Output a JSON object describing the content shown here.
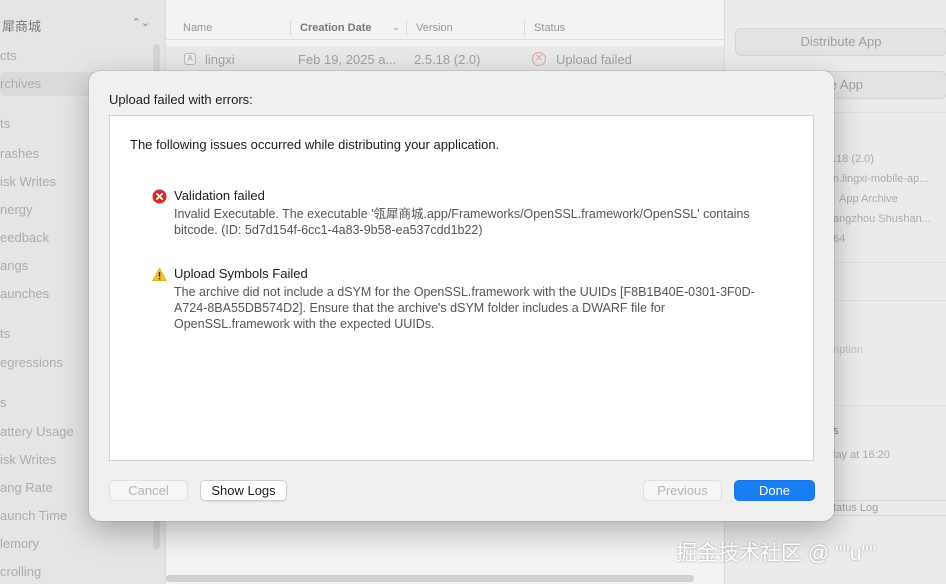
{
  "sidebar": {
    "scheme_name": "犀商城",
    "items": [
      {
        "label": "cts"
      },
      {
        "label": "rchives"
      },
      {
        "label": "ts"
      },
      {
        "label": "rashes"
      },
      {
        "label": "isk Writes"
      },
      {
        "label": "nergy"
      },
      {
        "label": "eedback"
      },
      {
        "label": "angs"
      },
      {
        "label": "aunches"
      },
      {
        "label": "ts"
      },
      {
        "label": "egressions"
      },
      {
        "label": "s"
      },
      {
        "label": "attery Usage"
      },
      {
        "label": "isk Writes"
      },
      {
        "label": "ang Rate"
      },
      {
        "label": "aunch Time"
      },
      {
        "label": "lemory"
      },
      {
        "label": "crolling"
      }
    ]
  },
  "table": {
    "columns": [
      "Name",
      "Creation Date",
      "Version",
      "Status"
    ],
    "rows": [
      {
        "name": "lingxi",
        "date": "Feb 19, 2025 a...",
        "version": "2.5.18 (2.0)",
        "status": "Upload failed"
      }
    ]
  },
  "inspector": {
    "distribute_label": "Distribute App",
    "validate_label": "ate App",
    "info": [
      ".18 (2.0)",
      "n.lingxi-mobile-ap...",
      "App Archive",
      "angzhou Shushan...",
      "64"
    ],
    "description_placeholder": "ription",
    "section_label": "s",
    "time_label": "lay at 16:20",
    "status_log": "tatus Log"
  },
  "dialog": {
    "title": "Upload failed with errors:",
    "intro": "The following issues occurred while distributing your application.",
    "issues": [
      {
        "severity": "error",
        "heading": "Validation failed",
        "detail": "Invalid Executable. The executable '瓴犀商城.app/Frameworks/OpenSSL.framework/OpenSSL' contains bitcode. (ID: 5d7d154f-6cc1-4a83-9b58-ea537cdd1b22)"
      },
      {
        "severity": "warning",
        "heading": "Upload Symbols Failed",
        "detail": "The archive did not include a dSYM for the OpenSSL.framework with the UUIDs [F8B1B40E-0301-3F0D-A724-8BA55DB574D2]. Ensure that the archive's dSYM folder includes a DWARF file for OpenSSL.framework with the expected UUIDs."
      }
    ],
    "buttons": {
      "cancel": "Cancel",
      "show_logs": "Show Logs",
      "previous": "Previous",
      "done": "Done"
    }
  },
  "watermark": "掘金技术社区 @ \"\"u\"\"",
  "colors": {
    "accent": "#1a7ef3",
    "error": "#d0302b",
    "warning": "#f4bf2a"
  }
}
